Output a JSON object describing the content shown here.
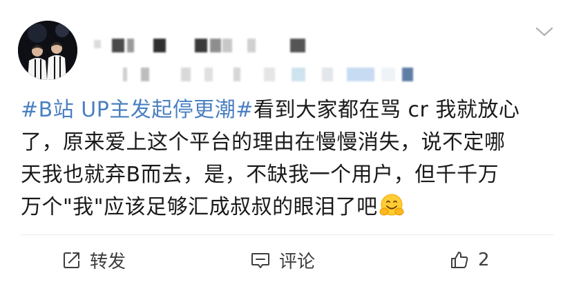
{
  "post": {
    "hashtag": "#B站 UP主发起停更潮#",
    "text_lines": [
      "看到大家都在骂 cr 我就放心",
      "了，原来爱上这个平台的理由在慢慢消失，说不定哪",
      "天我也就弃B而去，是，不缺我一个用户，但千千万",
      "万个\"我\"应该足够汇成叔叔的眼泪了吧"
    ],
    "emoji": "hugging-face-emoji"
  },
  "header": {
    "avatar_icon": "avatar-photo",
    "menu_icon": "chevron-down-icon"
  },
  "actions": {
    "repost_label": "转发",
    "comment_label": "评论",
    "like_count": "2",
    "repost_icon": "share-icon",
    "comment_icon": "comment-icon",
    "like_icon": "thumbs-up-icon"
  },
  "colors": {
    "hashtag": "#4a7fc1",
    "text": "#1a1a1a",
    "action_text": "#3d3d3d",
    "divider": "#ececec"
  }
}
